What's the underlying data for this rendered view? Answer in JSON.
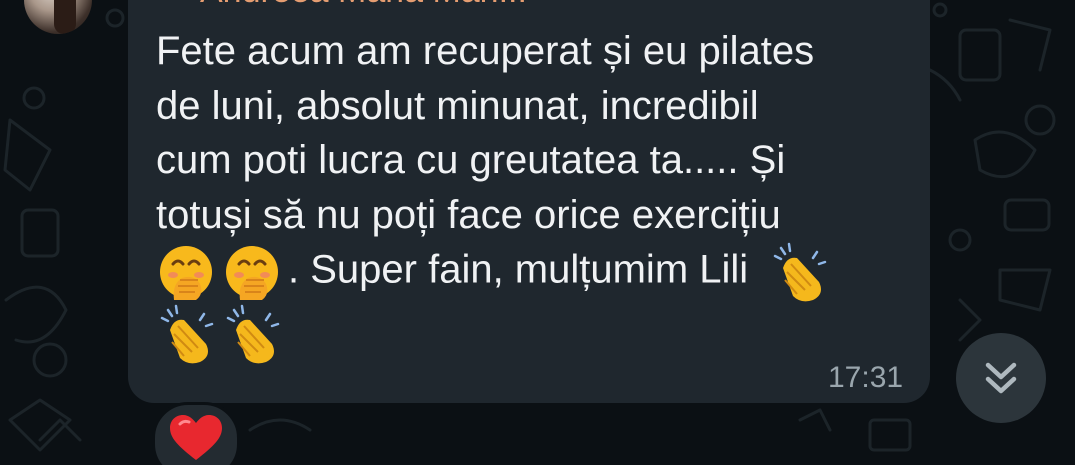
{
  "chat": {
    "sender_name": "Andreea Maria Mari...",
    "message_lines": [
      "Fete acum am recuperat și eu pilates",
      "de luni, absolut minunat, incredibil",
      "cum poti lucra cu greutatea ta..... Și",
      "totuși să nu poți face orice exercițiu"
    ],
    "message_line5_text": ". Super fain, mulțumim Lili",
    "time": "17:31",
    "emojis": [
      "face-with-hand-over-mouth-icon",
      "face-with-hand-over-mouth-icon",
      "clapping-hands-icon",
      "clapping-hands-icon",
      "clapping-hands-icon"
    ],
    "reaction": "red-heart-icon"
  },
  "colors": {
    "background": "#0b1014",
    "bubble": "#1f272e",
    "sender": "#e59d71",
    "text": "#f0f2f4",
    "time": "#9aa6ad"
  }
}
